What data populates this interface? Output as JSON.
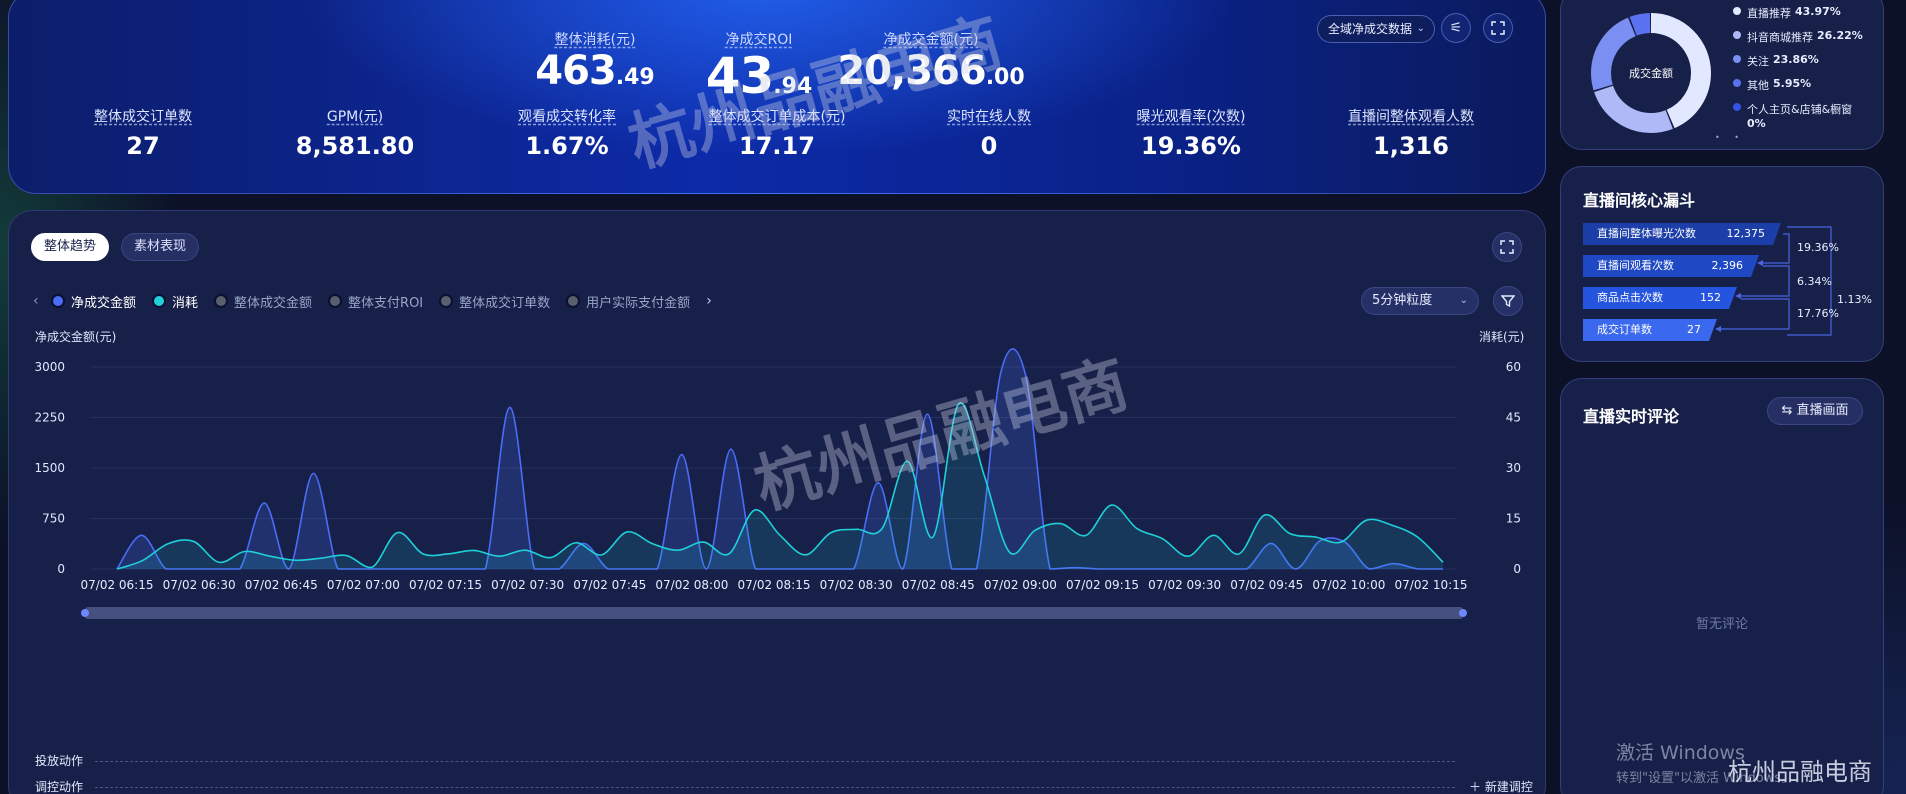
{
  "kpi": {
    "big": [
      {
        "label": "整体消耗(元)",
        "int": "463",
        "dec": ".49"
      },
      {
        "label": "净成交ROI",
        "int": "43",
        "dec": ".94"
      },
      {
        "label": "净成交金额(元)",
        "int": "20,366",
        "dec": ".00"
      }
    ],
    "small": [
      {
        "label": "整体成交订单数",
        "value": "27"
      },
      {
        "label": "GPM(元)",
        "value": "8,581.80"
      },
      {
        "label": "观看成交转化率",
        "value": "1.67%"
      },
      {
        "label": "整体成交订单成本(元)",
        "value": "17.17"
      },
      {
        "label": "实时在线人数",
        "value": "0"
      },
      {
        "label": "曝光观看率(次数)",
        "value": "19.36%"
      },
      {
        "label": "直播间整体观看人数",
        "value": "1,316"
      }
    ],
    "scope_select": "全域净成交数据"
  },
  "chart_panel": {
    "tabs": [
      "整体趋势",
      "素材表现"
    ],
    "legend": [
      {
        "name": "净成交金额",
        "color": "#4a6cf7",
        "active": true
      },
      {
        "name": "消耗",
        "color": "#1fd0d8",
        "active": true
      },
      {
        "name": "整体成交金额",
        "color": "#5a5f6e",
        "active": false
      },
      {
        "name": "整体支付ROI",
        "color": "#5a5f6e",
        "active": false
      },
      {
        "name": "整体成交订单数",
        "color": "#5a5f6e",
        "active": false
      },
      {
        "name": "用户实际支付金额",
        "color": "#5a5f6e",
        "active": false
      }
    ],
    "granularity": "5分钟粒度",
    "action_rows": [
      "投放动作",
      "调控动作"
    ],
    "new_adjust": "新建调控"
  },
  "chart_data": {
    "type": "area",
    "ylabel": "净成交金额(元)",
    "y2label": "消耗(元)",
    "ylim": [
      0,
      3000
    ],
    "y_ticks": [
      0,
      750,
      1500,
      2250,
      3000
    ],
    "y2lim": [
      0,
      60
    ],
    "y2_ticks": [
      0,
      15,
      30,
      45,
      60
    ],
    "x_labels": [
      "07/02 06:15",
      "07/02 06:30",
      "07/02 06:45",
      "07/02 07:00",
      "07/02 07:15",
      "07/02 07:30",
      "07/02 07:45",
      "07/02 08:00",
      "07/02 08:15",
      "07/02 08:30",
      "07/02 08:45",
      "07/02 09:00",
      "07/02 09:15",
      "07/02 09:30",
      "07/02 09:45",
      "07/02 10:00",
      "07/02 10:15"
    ],
    "series": [
      {
        "name": "净成交金额",
        "axis": "left",
        "color": "#4a6cf7",
        "values": [
          0,
          500,
          0,
          0,
          0,
          0,
          980,
          0,
          1420,
          0,
          0,
          0,
          0,
          0,
          0,
          0,
          2400,
          0,
          0,
          380,
          0,
          0,
          0,
          1700,
          0,
          1780,
          0,
          0,
          0,
          0,
          0,
          1280,
          0,
          2300,
          0,
          0,
          2930,
          2880,
          0,
          20,
          0,
          0,
          0,
          0,
          0,
          0,
          0,
          380,
          0,
          420,
          400,
          0,
          80,
          0,
          0
        ]
      },
      {
        "name": "消耗",
        "axis": "right",
        "color": "#1fd0d8",
        "values": [
          0,
          2.5,
          7.5,
          8.2,
          2,
          5.2,
          3.8,
          2.6,
          3.2,
          4,
          0.5,
          10.8,
          4.5,
          4.5,
          5.5,
          3.8,
          5.6,
          3.4,
          7.8,
          4.2,
          11,
          7.5,
          5.6,
          8,
          4.5,
          17.5,
          10,
          4.2,
          10.8,
          11.8,
          12,
          32,
          9.5,
          49,
          28,
          5,
          11.5,
          13.5,
          10,
          19,
          12,
          9,
          3.8,
          10,
          4.5,
          16,
          10.5,
          9.5,
          8,
          14.5,
          13,
          9.5,
          2
        ]
      }
    ]
  },
  "sales_pie": {
    "center_label": "成交金额",
    "slices": [
      {
        "name": "直播推荐",
        "pct": "43.97%",
        "value": 43.97,
        "color": "#e2e8ff"
      },
      {
        "name": "抖音商城推荐",
        "pct": "26.22%",
        "value": 26.22,
        "color": "#aeb9f7"
      },
      {
        "name": "关注",
        "pct": "23.86%",
        "value": 23.86,
        "color": "#7b8ff2"
      },
      {
        "name": "其他",
        "pct": "5.95%",
        "value": 5.95,
        "color": "#5a72ef"
      },
      {
        "name": "个人主页&店铺&橱窗",
        "pct": "0%",
        "value": 0,
        "color": "#3454e8"
      }
    ]
  },
  "funnel": {
    "title": "直播间核心漏斗",
    "stages": [
      {
        "name": "直播间整体曝光次数",
        "value": "12,375",
        "color": "#1b3ea8"
      },
      {
        "name": "直播间观看次数",
        "value": "2,396",
        "color": "#1f49c4"
      },
      {
        "name": "商品点击次数",
        "value": "152",
        "color": "#2554de"
      },
      {
        "name": "成交订单数",
        "value": "27",
        "color": "#3a68ef"
      }
    ],
    "rates": [
      "19.36%",
      "6.34%",
      "17.76%"
    ],
    "overall_rate": "1.13%"
  },
  "comments": {
    "title": "直播实时评论",
    "toggle_label": "⇆ 直播画面",
    "empty": "暂无评论"
  },
  "watermark": {
    "text": "杭州品融电商"
  },
  "windows_activation": {
    "line1": "激活 Windows",
    "line2": "转到\"设置\"以激活 Windows。"
  }
}
